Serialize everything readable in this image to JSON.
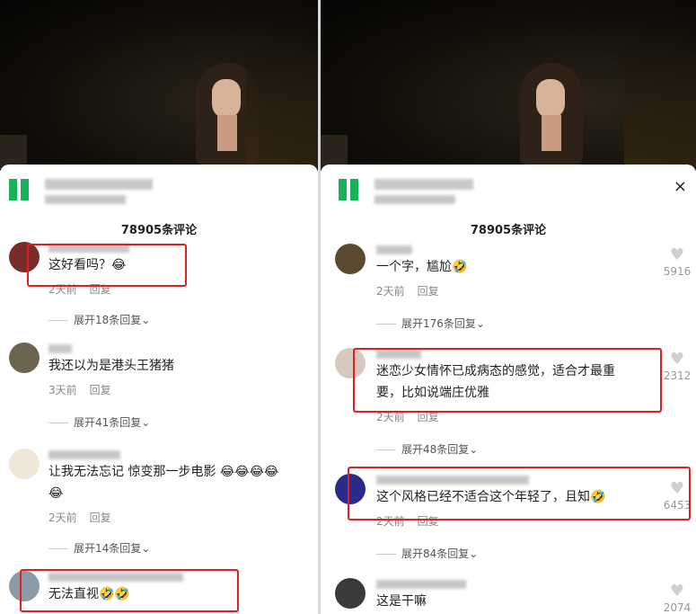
{
  "left": {
    "comment_count": "78905条评论",
    "comments": [
      {
        "text": "这好看吗？😂",
        "time": "2天前",
        "reply": "回复",
        "expand": "展开18条回复"
      },
      {
        "text": "我还以为是港头王猪猪",
        "time": "3天前",
        "reply": "回复",
        "expand": "展开41条回复"
      },
      {
        "text": "让我无法忘记 惊变那一步电影 😂😂😂😂",
        "text2": "😂",
        "time": "2天前",
        "reply": "回复",
        "expand": "展开14条回复"
      },
      {
        "text": "无法直视🤣🤣"
      }
    ]
  },
  "right": {
    "comment_count": "78905条评论",
    "close_icon": "×",
    "comments": [
      {
        "text": "一个字，尴尬🤣",
        "time": "2天前",
        "reply": "回复",
        "expand": "展开176条回复",
        "likes": "5916"
      },
      {
        "text": "迷恋少女情怀已成病态的感觉，适合才最重",
        "text2": "要，比如说端庄优雅",
        "time": "2天前",
        "reply": "回复",
        "expand": "展开48条回复",
        "likes": "2312"
      },
      {
        "text": "这个风格已经不适合这个年轻了，且知🤣",
        "time": "2天前",
        "reply": "回复",
        "expand": "展开84条回复",
        "likes": "6453"
      },
      {
        "text": "这是干嘛",
        "likes": "2074"
      }
    ]
  },
  "colors": {
    "highlight": "#e02020",
    "ad_green": "#18b25c",
    "video_bg": "#120f0a"
  }
}
